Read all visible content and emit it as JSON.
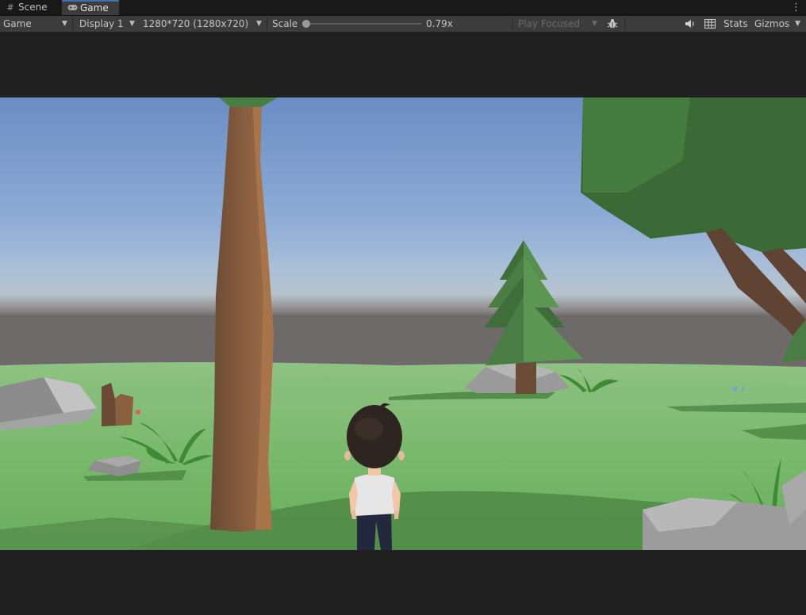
{
  "tabs": {
    "scene": "Scene",
    "game": "Game"
  },
  "toolbar": {
    "mode": "Game",
    "display": "Display 1",
    "resolution": "1280*720 (1280x720)",
    "scale_label": "Scale",
    "scale_value": "0.79x",
    "play_focused": "Play Focused",
    "stats": "Stats",
    "gizmos": "Gizmos"
  },
  "icons": {
    "scene_tab": "grid-icon",
    "game_tab": "gamepad-icon",
    "bug": "bug-icon",
    "audio": "speaker-icon",
    "grid": "grid-toggle-icon",
    "menu": "kebab-menu-icon"
  },
  "colors": {
    "editor_bg": "#1e1e1e",
    "toolbar_bg": "#3c3c3c",
    "tab_active_accent": "#3a72b0",
    "sky_top": "#6a8dc4",
    "grass": "#76b86a"
  }
}
